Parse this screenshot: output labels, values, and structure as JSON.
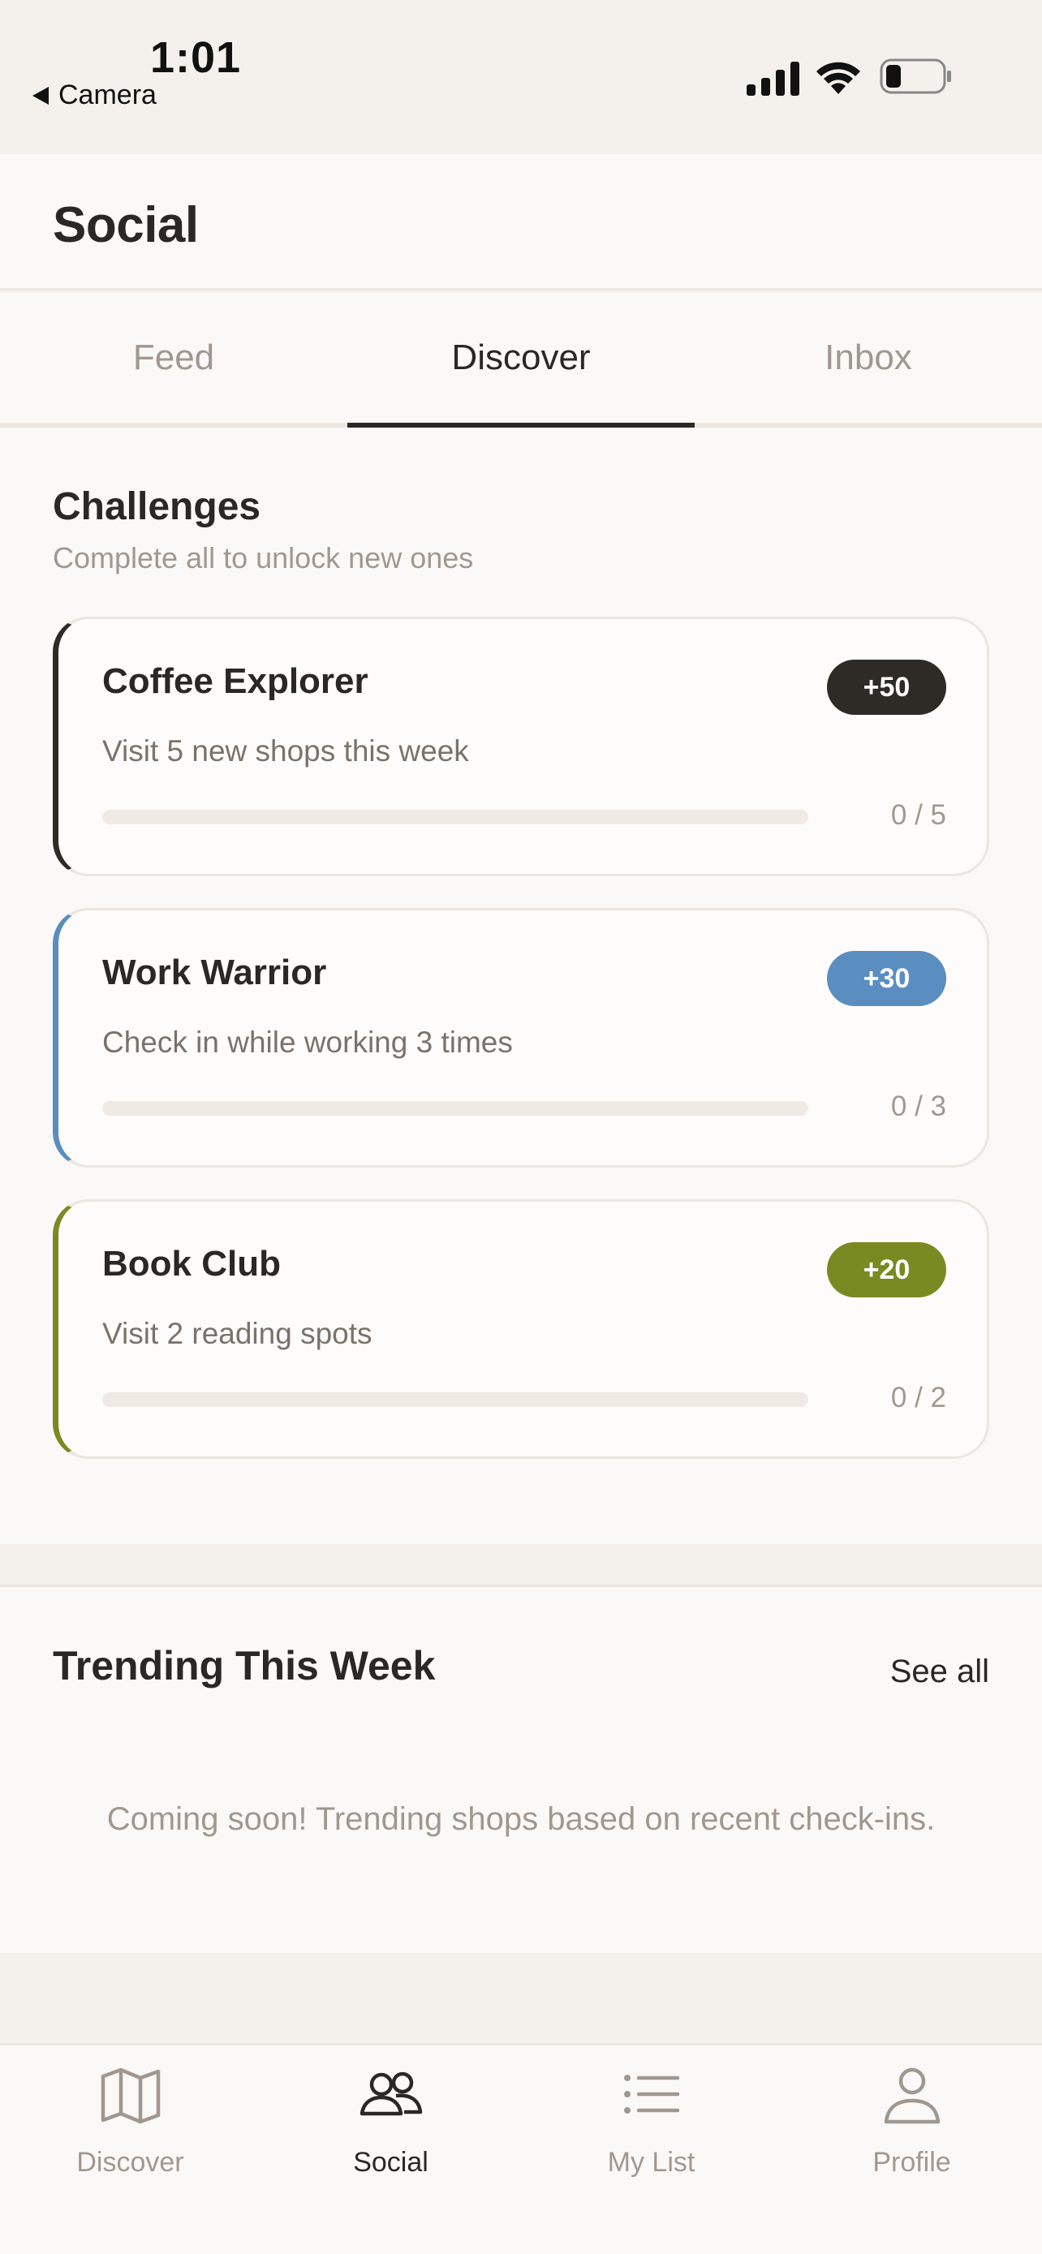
{
  "status_bar": {
    "time": "1:01",
    "back_app": "Camera"
  },
  "header": {
    "title": "Social"
  },
  "tabs": [
    {
      "label": "Feed",
      "active": false
    },
    {
      "label": "Discover",
      "active": true
    },
    {
      "label": "Inbox",
      "active": false
    }
  ],
  "challenges": {
    "title": "Challenges",
    "subtitle": "Complete all to unlock new ones",
    "items": [
      {
        "title": "Coffee Explorer",
        "description": "Visit 5 new shops this week",
        "points": "+50",
        "progress_text": "0 / 5",
        "progress": 0,
        "accent": "#2e2a26"
      },
      {
        "title": "Work Warrior",
        "description": "Check in while working 3 times",
        "points": "+30",
        "progress_text": "0 / 3",
        "progress": 0,
        "accent": "#5b8ec0"
      },
      {
        "title": "Book Club",
        "description": "Visit 2 reading spots",
        "points": "+20",
        "progress_text": "0 / 2",
        "progress": 0,
        "accent": "#7a8a22"
      }
    ]
  },
  "trending": {
    "title": "Trending This Week",
    "see_all": "See all",
    "empty_message": "Coming soon! Trending shops based on recent check-ins."
  },
  "bottom_nav": [
    {
      "label": "Discover",
      "icon": "map-icon",
      "active": false
    },
    {
      "label": "Social",
      "icon": "people-icon",
      "active": true
    },
    {
      "label": "My List",
      "icon": "list-icon",
      "active": false
    },
    {
      "label": "Profile",
      "icon": "person-icon",
      "active": false
    }
  ],
  "colors": {
    "background": "#fbf9f7",
    "text_primary": "#2b2724",
    "text_muted": "#a09890",
    "accent_dark": "#2e2a26",
    "accent_blue": "#5b8ec0",
    "accent_olive": "#7a8a22"
  }
}
